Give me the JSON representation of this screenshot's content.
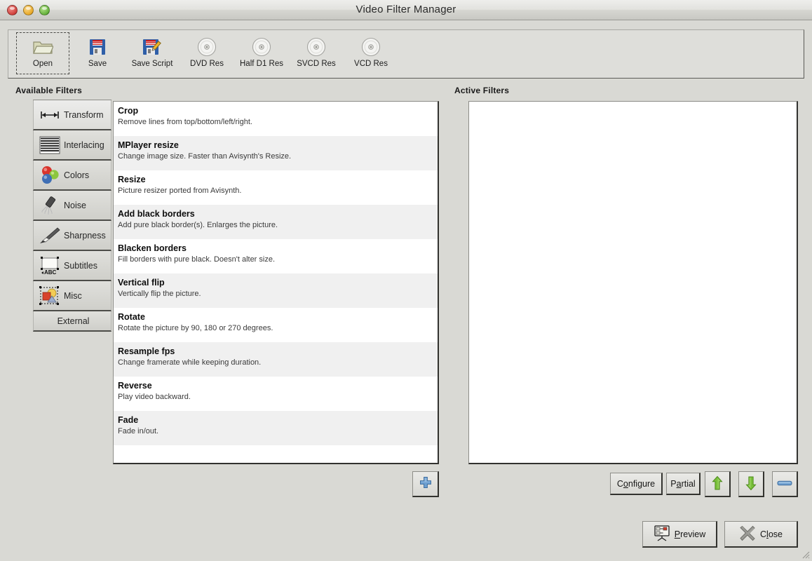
{
  "window": {
    "title": "Video Filter Manager",
    "controls": [
      {
        "name": "close-window-button",
        "color": "#d0413c"
      },
      {
        "name": "minimize-window-button",
        "color": "#e8a928"
      },
      {
        "name": "zoom-window-button",
        "color": "#66b23d"
      }
    ]
  },
  "toolbar": {
    "items": [
      {
        "label": "Open",
        "icon": "folder-open-icon",
        "focused": true
      },
      {
        "label": "Save",
        "icon": "floppy-disk-icon",
        "focused": false
      },
      {
        "label": "Save Script",
        "icon": "floppy-disk-pencil-icon",
        "focused": false
      },
      {
        "label": "DVD Res",
        "icon": "disc-icon",
        "focused": false
      },
      {
        "label": "Half D1 Res",
        "icon": "disc-icon",
        "focused": false
      },
      {
        "label": "SVCD Res",
        "icon": "disc-icon",
        "focused": false
      },
      {
        "label": "VCD Res",
        "icon": "disc-icon",
        "focused": false
      }
    ]
  },
  "available_filters": {
    "heading": "Available Filters",
    "categories": [
      {
        "label": "Transform",
        "icon": "transform-arrows-icon",
        "selected": true
      },
      {
        "label": "Interlacing",
        "icon": "interlacing-lines-icon",
        "selected": false
      },
      {
        "label": "Colors",
        "icon": "color-spheres-icon",
        "selected": false
      },
      {
        "label": "Noise",
        "icon": "noise-spray-icon",
        "selected": false
      },
      {
        "label": "Sharpness",
        "icon": "sharpness-brush-icon",
        "selected": false
      },
      {
        "label": "Subtitles",
        "icon": "subtitles-abc-icon",
        "selected": false
      },
      {
        "label": "Misc",
        "icon": "misc-shapes-icon",
        "selected": false
      },
      {
        "label": "External",
        "icon": "",
        "selected": false
      }
    ],
    "filters": [
      {
        "name": "Crop",
        "desc": "Remove lines from top/bottom/left/right."
      },
      {
        "name": "MPlayer resize",
        "desc": "Change image size. Faster than Avisynth's Resize."
      },
      {
        "name": "Resize",
        "desc": "Picture resizer ported from Avisynth."
      },
      {
        "name": "Add black borders",
        "desc": "Add pure black border(s). Enlarges the picture."
      },
      {
        "name": "Blacken borders",
        "desc": "Fill borders with pure black. Doesn't alter size."
      },
      {
        "name": "Vertical flip",
        "desc": "Vertically flip the picture."
      },
      {
        "name": "Rotate",
        "desc": "Rotate the picture by 90, 180 or 270 degrees."
      },
      {
        "name": "Resample fps",
        "desc": "Change framerate while keeping duration."
      },
      {
        "name": "Reverse",
        "desc": "Play video backward."
      },
      {
        "name": "Fade",
        "desc": "Fade in/out."
      }
    ],
    "add_button": {
      "label": "",
      "icon": "plus-icon"
    }
  },
  "active_filters": {
    "heading": "Active Filters",
    "items": [],
    "buttons": [
      {
        "label": "Configure",
        "icon": "",
        "accel_index": 1
      },
      {
        "label": "Partial",
        "icon": "",
        "accel_index": 1
      },
      {
        "label": "",
        "icon": "arrow-up-icon"
      },
      {
        "label": "",
        "icon": "arrow-down-icon"
      },
      {
        "label": "",
        "icon": "minus-icon"
      }
    ]
  },
  "footer": {
    "preview": {
      "label": "Preview",
      "icon": "preview-screen-icon"
    },
    "close": {
      "label": "Close",
      "icon": "x-cross-icon"
    }
  }
}
